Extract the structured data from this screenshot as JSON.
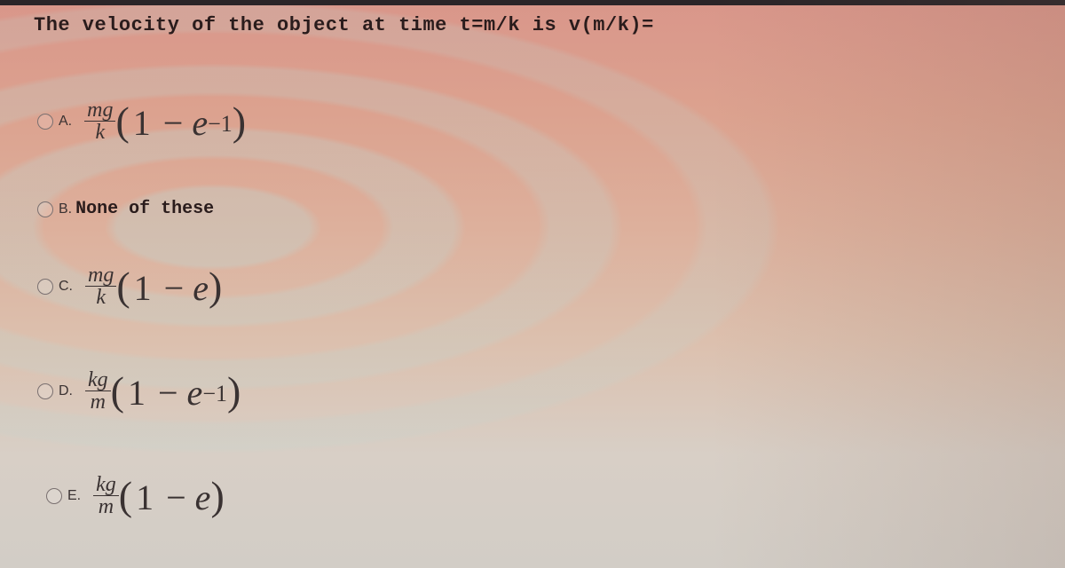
{
  "question": "The velocity of the object at time t=m/k is v(m/k)=",
  "options": [
    {
      "letter": "A.",
      "numerator": "mg",
      "denominator": "k",
      "one": "1",
      "minus": "−",
      "base": "e",
      "exponent": "−1"
    },
    {
      "letter": "B.",
      "text": "None of these"
    },
    {
      "letter": "C.",
      "numerator": "mg",
      "denominator": "k",
      "one": "1",
      "minus": "−",
      "base": "e",
      "exponent": ""
    },
    {
      "letter": "D.",
      "numerator": "kg",
      "denominator": "m",
      "one": "1",
      "minus": "−",
      "base": "e",
      "exponent": "−1"
    },
    {
      "letter": "E.",
      "numerator": "kg",
      "denominator": "m",
      "one": "1",
      "minus": "−",
      "base": "e",
      "exponent": ""
    }
  ],
  "paren_open": "(",
  "paren_close": ")"
}
